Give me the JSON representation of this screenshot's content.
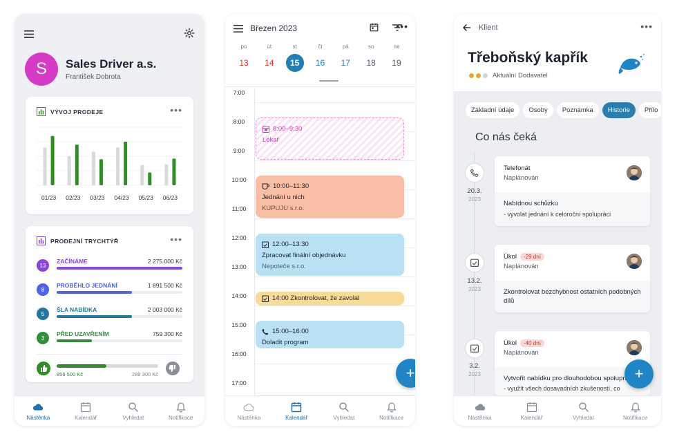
{
  "nav": [
    {
      "label": "Nástěnka",
      "icon": "cloud-icon"
    },
    {
      "label": "Kalendář",
      "icon": "calendar-icon"
    },
    {
      "label": "Vyhledat",
      "icon": "search-icon"
    },
    {
      "label": "Notifikace",
      "icon": "bell-icon"
    }
  ],
  "dashboard": {
    "avatar_letter": "S",
    "company": "Sales Driver a.s.",
    "person": "František Dobrota",
    "sales_title": "VÝVOJ PRODEJE",
    "funnel_title": "PRODEJNÍ TRYCHTÝŘ",
    "more": "•••",
    "funnel": [
      {
        "count": "13",
        "name": "ZAČÍNÁME",
        "value": "2 275 000 Kč",
        "color": "#8a44e0",
        "fill": 1.0
      },
      {
        "count": "8",
        "name": "PROBĚHLO JEDNÁNÍ",
        "value": "1 891 500 Kč",
        "color": "#4f62e8",
        "fill": 0.6
      },
      {
        "count": "5",
        "name": "ŠLA NABÍDKA",
        "value": "2 003 000 Kč",
        "color": "#1f7a9e",
        "fill": 0.6
      },
      {
        "count": "3",
        "name": "PŘED UZAVŘENÍM",
        "value": "759 300 Kč",
        "color": "#2f8f3a",
        "fill": 0.28
      }
    ],
    "won_value": "856 500 Kč",
    "lost_value": "289 300 Kč",
    "won_fill": 0.49
  },
  "chart_data": {
    "type": "bar",
    "categories": [
      "01/23",
      "02/23",
      "03/23",
      "04/23",
      "05/23",
      "06/23"
    ],
    "series": [
      {
        "values": [
          6.5,
          5.0,
          5.8,
          6.5,
          3.5,
          3.6
        ],
        "color": "#d8dadd"
      },
      {
        "values": [
          8.5,
          7.0,
          4.5,
          7.5,
          2.2,
          4.6
        ],
        "color": "#2f8f24"
      }
    ],
    "ylim": [
      0,
      10
    ]
  },
  "calendar": {
    "month": "Březen 2023",
    "days": [
      {
        "d": "po",
        "n": "13",
        "color": "#d9362b"
      },
      {
        "d": "út",
        "n": "14",
        "color": "#d9362b"
      },
      {
        "d": "st",
        "n": "15",
        "color": "#ffffff",
        "selected": true
      },
      {
        "d": "čt",
        "n": "16",
        "color": "#1f7fb4"
      },
      {
        "d": "pá",
        "n": "17",
        "color": "#1f7fb4"
      },
      {
        "d": "so",
        "n": "18",
        "color": "#555c66"
      },
      {
        "d": "ne",
        "n": "19",
        "color": "#555c66"
      }
    ],
    "hours": [
      "7:00",
      "8:00",
      "9:00",
      "10:00",
      "11:00",
      "12:00",
      "13:00",
      "14:00",
      "15:00",
      "16:00",
      "17:00"
    ],
    "events": {
      "e1": {
        "time": "8:00–9:30",
        "title": "Lékař"
      },
      "e2": {
        "time": "10:00–11:30",
        "title": "Jednání u nich",
        "place": "KUPUJU s.r.o."
      },
      "e3": {
        "time": "12:00–13:30",
        "title": "Zpracovat finální objednávku",
        "place": "Nepoteče s.r.o."
      },
      "e4": {
        "title": "14:00 Zkontrolovat, že zavolal"
      },
      "e5": {
        "time": "15:00–16:00",
        "title": "Doladit program"
      }
    },
    "fab": "+"
  },
  "client": {
    "header": "Klient",
    "name": "Třeboňský kapřík",
    "status": "Aktuální Dodavatel",
    "tabs": [
      "Základní údaje",
      "Osoby",
      "Poznámka",
      "Historie",
      "Přílo"
    ],
    "section": "Co nás čeká",
    "tasks": [
      {
        "date": "20.3.",
        "year": "2023",
        "type": "Telefonát",
        "state": "Naplánován",
        "text": "Nabídnou schůzku",
        "sub": "- vyvolat jednání k celoroční spolupráci"
      },
      {
        "date": "13.2.",
        "year": "2023",
        "type": "Úkol",
        "tag": "-29 dní",
        "state": "Naplánován",
        "text": "Zkontrolovat bezchybnost ostatních podobných dílů"
      },
      {
        "date": "3.2.",
        "year": "2023",
        "type": "Úkol",
        "tag": "-40 dní",
        "state": "Naplánován",
        "text": "Vytvořit nabídku pro dlouhodobou spolupráci",
        "sub": "- využít všech dosavadních zkušeností, co"
      }
    ],
    "fab": "+"
  }
}
